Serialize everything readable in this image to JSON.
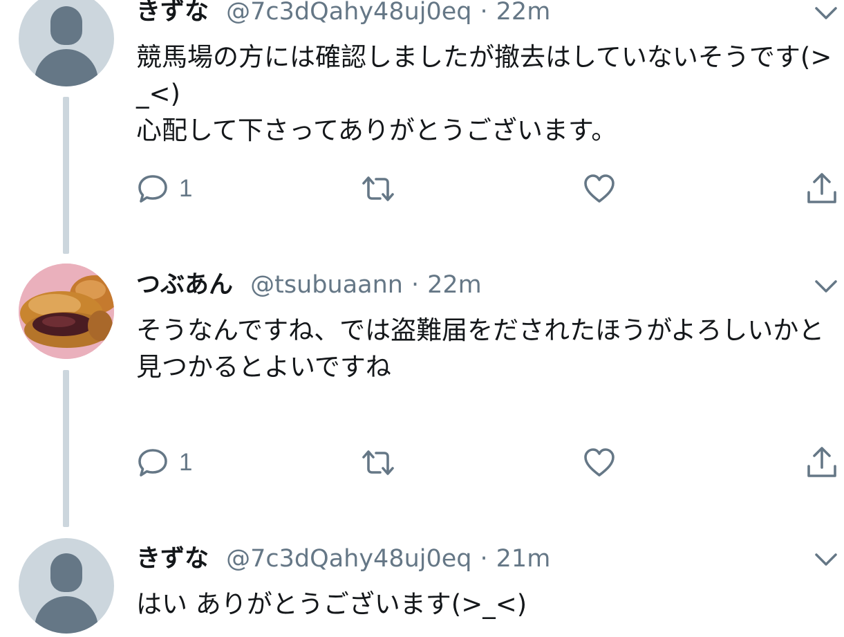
{
  "tweets": [
    {
      "name": "きずな",
      "handle": "@7c3dQahy48uj0eq",
      "separator": "·",
      "time": "22m",
      "text": "競馬場の方には確認しましたが撤去はしていないそうです(>_<)\n心配して下さってありがとうございます。",
      "reply_count": "1"
    },
    {
      "name": "つぶあん",
      "handle": "@tsubuaann",
      "separator": "·",
      "time": "22m",
      "text": "そうなんですね、では盗難届をだされたほうがよろしいかと\n見つかるとよいですね",
      "reply_count": "1"
    },
    {
      "name": "きずな",
      "handle": "@7c3dQahy48uj0eq",
      "separator": "·",
      "time": "21m",
      "text": "はい ありがとうございます(>_<)"
    }
  ],
  "icons": {
    "reply": "reply-icon",
    "retweet": "retweet-icon",
    "like": "heart-icon",
    "share": "share-icon",
    "more": "chevron-down-icon",
    "default_avatar": "default-avatar-icon"
  },
  "colors": {
    "text": "#14171a",
    "secondary": "#657786",
    "thread_line": "#ccd6dd"
  }
}
